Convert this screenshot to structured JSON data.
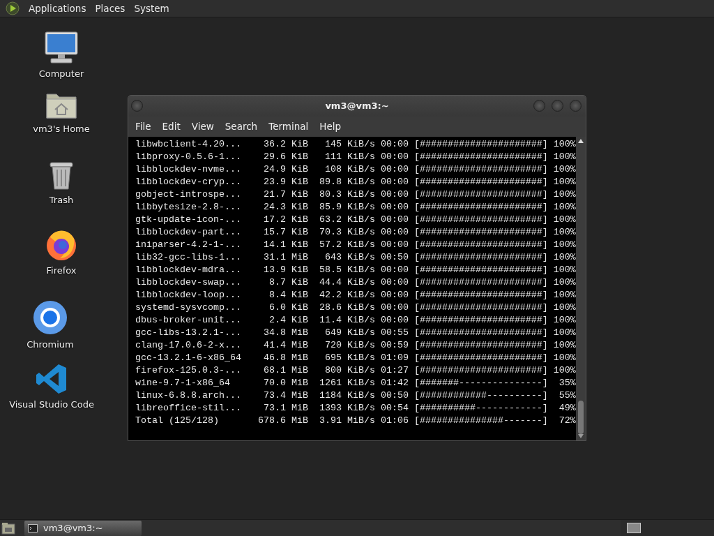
{
  "top_panel": {
    "menus": [
      "Applications",
      "Places",
      "System"
    ]
  },
  "desktop_icons": [
    {
      "kind": "computer",
      "label": "Computer"
    },
    {
      "kind": "home",
      "label": "vm3's Home"
    },
    {
      "kind": "trash",
      "label": "Trash"
    },
    {
      "kind": "firefox",
      "label": "Firefox"
    },
    {
      "kind": "chromium",
      "label": "Chromium"
    },
    {
      "kind": "vscode",
      "label": "Visual Studio Code"
    }
  ],
  "terminal": {
    "title": "vm3@vm3:~",
    "menu": [
      "File",
      "Edit",
      "View",
      "Search",
      "Terminal",
      "Help"
    ],
    "lines": [
      "libwbclient-4.20...    36.2 KiB   145 KiB/s 00:00 [######################] 100%",
      "libproxy-0.5.6-1...    29.6 KiB   111 KiB/s 00:00 [######################] 100%",
      "libblockdev-nvme...    24.9 KiB   108 KiB/s 00:00 [######################] 100%",
      "libblockdev-cryp...    23.9 KiB  89.8 KiB/s 00:00 [######################] 100%",
      "gobject-introspe...    21.7 KiB  80.3 KiB/s 00:00 [######################] 100%",
      "libbytesize-2.8-...    24.3 KiB  85.9 KiB/s 00:00 [######################] 100%",
      "gtk-update-icon-...    17.2 KiB  63.2 KiB/s 00:00 [######################] 100%",
      "libblockdev-part...    15.7 KiB  70.3 KiB/s 00:00 [######################] 100%",
      "iniparser-4.2-1-...    14.1 KiB  57.2 KiB/s 00:00 [######################] 100%",
      "lib32-gcc-libs-1...    31.1 MiB   643 KiB/s 00:50 [######################] 100%",
      "libblockdev-mdra...    13.9 KiB  58.5 KiB/s 00:00 [######################] 100%",
      "libblockdev-swap...     8.7 KiB  44.4 KiB/s 00:00 [######################] 100%",
      "libblockdev-loop...     8.4 KiB  42.2 KiB/s 00:00 [######################] 100%",
      "systemd-sysvcomp...     6.0 KiB  28.6 KiB/s 00:00 [######################] 100%",
      "dbus-broker-unit...     2.4 KiB  11.4 KiB/s 00:00 [######################] 100%",
      "gcc-libs-13.2.1-...    34.8 MiB   649 KiB/s 00:55 [######################] 100%",
      "clang-17.0.6-2-x...    41.4 MiB   720 KiB/s 00:59 [######################] 100%",
      "gcc-13.2.1-6-x86_64    46.8 MiB   695 KiB/s 01:09 [######################] 100%",
      "firefox-125.0.3-...    68.1 MiB   800 KiB/s 01:27 [######################] 100%",
      "wine-9.7-1-x86_64      70.0 MiB  1261 KiB/s 01:42 [#######---------------]  35%",
      "linux-6.8.8.arch...    73.4 MiB  1184 KiB/s 00:50 [############----------]  55%",
      "libreoffice-stil...    73.1 MiB  1393 KiB/s 00:54 [##########------------]  49%",
      "Total (125/128)       678.6 MiB  3.91 MiB/s 01:06 [###############-------]  72%"
    ]
  },
  "taskbar": {
    "tasks": [
      {
        "label": "vm3@vm3:~",
        "selected": true
      }
    ]
  }
}
